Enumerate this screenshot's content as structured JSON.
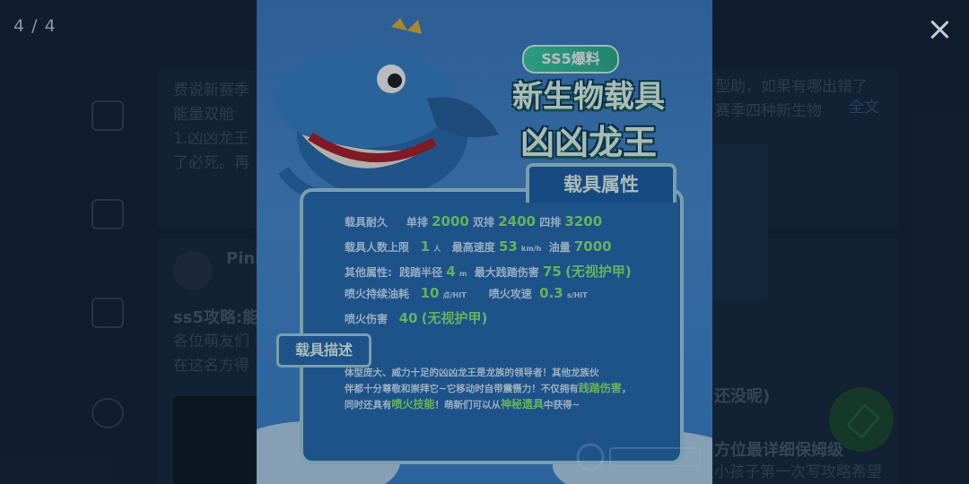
{
  "viewer": {
    "counter": "4 / 4"
  },
  "poster": {
    "badge": "SS5爆料",
    "headline_1": "新生物载具",
    "headline_2": "凶凶龙王",
    "attributes_title": "载具属性",
    "rows": [
      {
        "label": "载具耐久",
        "parts": [
          "单排",
          "2000",
          "双排",
          "2400",
          "四排",
          "3200"
        ]
      },
      {
        "label": "载具人数上限",
        "parts": [
          "1",
          "人",
          "最高速度",
          "53",
          "km/h",
          "油量",
          "7000"
        ]
      },
      {
        "label": "其他属性:",
        "parts": [
          "践踏半径",
          "4",
          "m",
          "最大践踏伤害",
          "75",
          "(无视护甲)"
        ]
      },
      {
        "label": "喷火持续油耗",
        "parts": [
          "10",
          "点/HIT",
          "喷火攻速",
          "0.3",
          "s/HIT"
        ]
      },
      {
        "label": "喷火伤害",
        "parts": [
          "40",
          "(无视护甲)"
        ]
      }
    ],
    "description_title": "载具描述",
    "description": [
      "体型庞大、威力十足的凶凶龙王是龙族的领导者！其他龙族伙",
      "伴都十分尊敬和崇拜它~它移动时自带震慑力！不仅拥有",
      "践踏伤害",
      "，同时还具有",
      "喷火技能",
      "！萌新们可以从",
      "神秘遗具",
      "中获得~"
    ]
  },
  "background": {
    "post1_line1": "费说新赛季",
    "post1_line1_right": "型助，如果有哪出错了",
    "post1_line2": "能量双舱",
    "post1_line2_right": "赛季四种新生物",
    "post1_more": "全文",
    "post1_line3": "1.凶凶龙王",
    "post1_line4": "了必死。再",
    "author": "Pink",
    "post2_title": "ss5攻略:能",
    "post2_line1": "各位萌友们",
    "post2_line2": "在这名方得",
    "post3_title_right": "还没呢)",
    "post3_title2": "方位最详细保姆级",
    "post3_line": "小孩子第一次写攻略希望"
  },
  "colors": {
    "accent_green": "#8ff07a",
    "panel_blue": "#2a6fb5",
    "border": "#a8d7e6"
  }
}
